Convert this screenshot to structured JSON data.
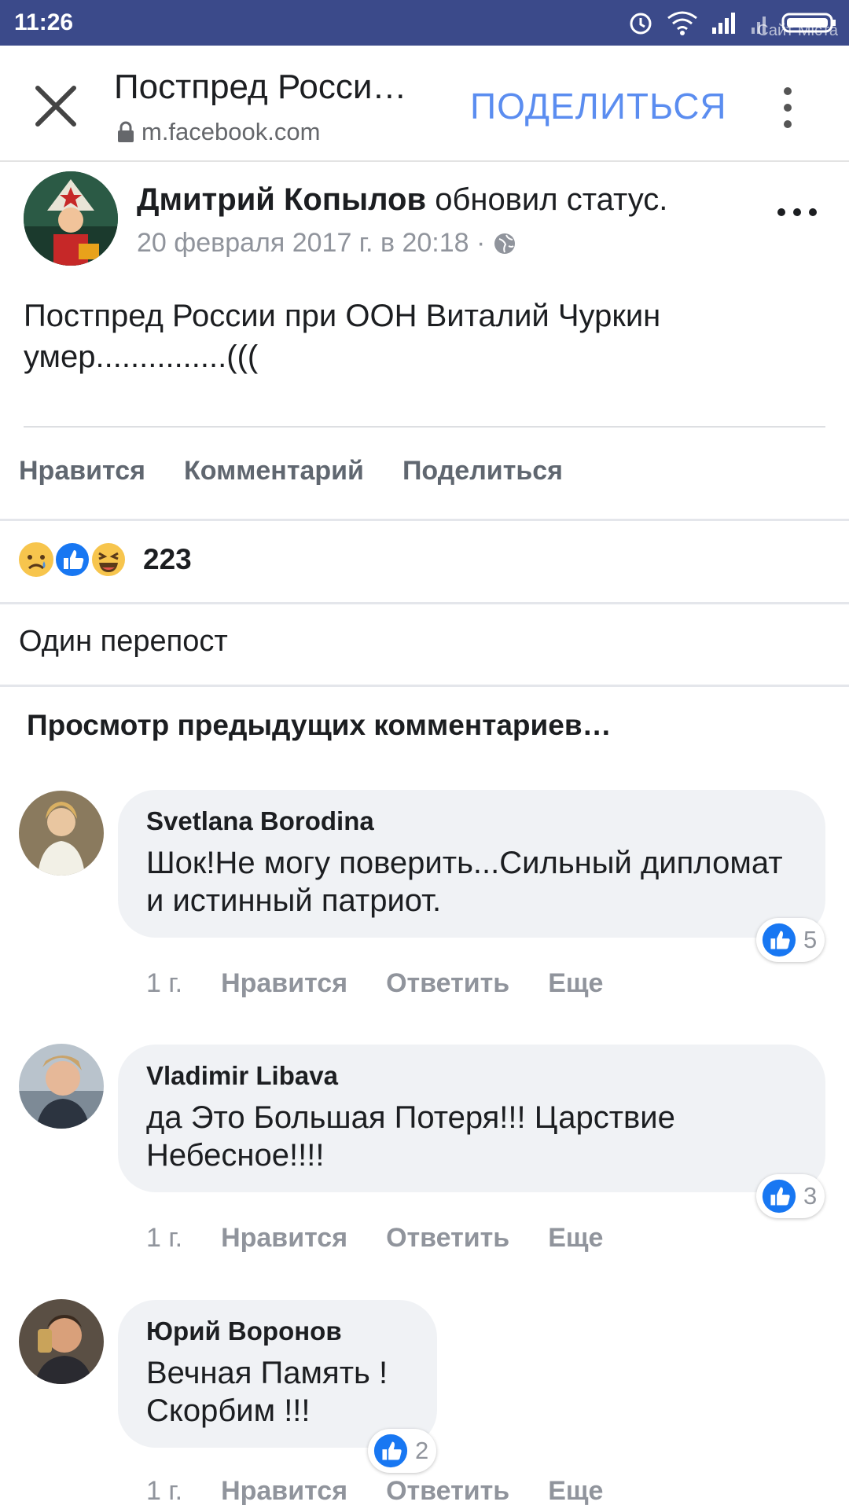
{
  "status_bar": {
    "time": "11:26",
    "watermark": "Сайт Мiста"
  },
  "browser": {
    "title": "Постпред Росси…",
    "url": "m.facebook.com",
    "share_label": "ПОДЕЛИТЬСЯ",
    "icons": [
      "close-icon",
      "lock-icon",
      "more-vertical-icon"
    ]
  },
  "post": {
    "author": "Дмитрий Копылов",
    "action": " обновил статус.",
    "date": "20 февраля 2017 г. в 20:18 ·",
    "text": "Постпред России при ООН Виталий Чуркин умер...............(((",
    "actions": {
      "like": "Нравится",
      "comment": "Комментарий",
      "share": "Поделиться"
    },
    "reaction_count": "223",
    "reactions": [
      "sad",
      "like",
      "haha"
    ],
    "reposts": "Один перепост"
  },
  "view_previous": "Просмотр предыдущих комментариев…",
  "comments": [
    {
      "author": "Svetlana Borodina",
      "text": "Шок!Не могу поверить...Сильный дипломат и истинный патриот.",
      "likes": "5",
      "time": "1 г.",
      "like": "Нравится",
      "reply": "Ответить",
      "more": "Еще"
    },
    {
      "author": "Vladimir Libava",
      "text": "да Это Большая Потеря!!! Царствие Небесное!!!!",
      "likes": "3",
      "time": "1 г.",
      "like": "Нравится",
      "reply": "Ответить",
      "more": "Еще"
    },
    {
      "author": "Юрий Воронов",
      "text": "Вечная Память ! Скорбим !!!",
      "likes": "2",
      "time": "1 г.",
      "like": "Нравится",
      "reply": "Ответить",
      "more": "Еще"
    }
  ],
  "colors": {
    "status_bar": "#3b4a8a",
    "accent": "#5b8df0",
    "like_blue": "#1877f2",
    "bubble": "#f0f2f5",
    "muted": "#90949c"
  }
}
